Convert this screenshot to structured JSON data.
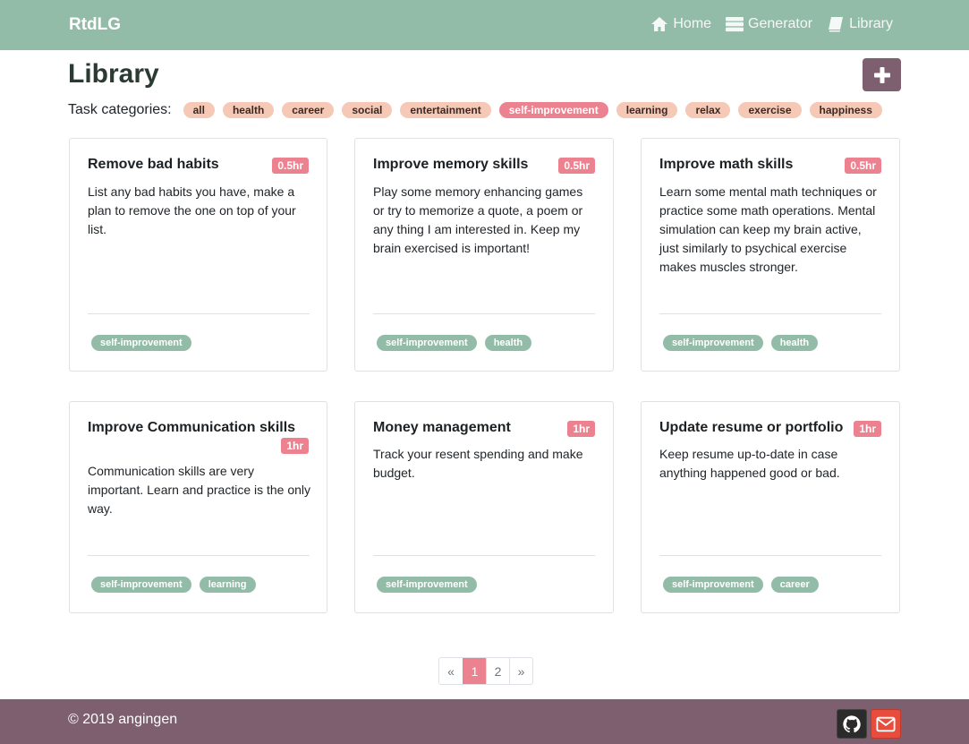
{
  "navbar": {
    "brand": "RtdLG",
    "links": [
      {
        "label": "Home",
        "icon": "home-icon"
      },
      {
        "label": "Generator",
        "icon": "server-icon"
      },
      {
        "label": "Library",
        "icon": "book-icon"
      }
    ]
  },
  "page": {
    "title": "Library",
    "add_button_icon": "plus-icon"
  },
  "categories": {
    "label": "Task categories:",
    "items": [
      "all",
      "health",
      "career",
      "social",
      "entertainment",
      "self-improvement",
      "learning",
      "relax",
      "exercise",
      "happiness"
    ],
    "active": "self-improvement"
  },
  "cards": [
    {
      "title": "Remove bad habits",
      "duration": "0.5hr",
      "text": "List any bad habits you have, make a plan to remove the one on top of your list.",
      "tags": [
        "self-improvement"
      ]
    },
    {
      "title": "Improve memory skills",
      "duration": "0.5hr",
      "text": "Play some memory enhancing games or try to memorize a quote, a poem or any thing I am interested in. Keep my brain exercised is important!",
      "tags": [
        "self-improvement",
        "health"
      ]
    },
    {
      "title": "Improve math skills",
      "duration": "0.5hr",
      "text": "Learn some mental math techniques or practice some math operations. Mental simulation can keep my brain active, just similarly to psychical exercise makes muscles stronger.",
      "tags": [
        "self-improvement",
        "health"
      ]
    },
    {
      "title": "Improve Communication skills",
      "duration": "1hr",
      "text": "Communication skills are very important. Learn and practice is the only way.",
      "tags": [
        "self-improvement",
        "learning"
      ]
    },
    {
      "title": "Money management",
      "duration": "1hr",
      "text": "Track your resent spending and make budget.",
      "tags": [
        "self-improvement"
      ]
    },
    {
      "title": "Update resume or portfolio",
      "duration": "1hr",
      "text": "Keep resume up-to-date in case anything happened good or bad.",
      "tags": [
        "self-improvement",
        "career"
      ]
    }
  ],
  "pagination": {
    "prev": "«",
    "pages": [
      "1",
      "2"
    ],
    "current": "1",
    "next": "»"
  },
  "footer": {
    "copyright": "© 2019 angingen",
    "github_icon": "github-icon",
    "mail_icon": "envelope-icon"
  },
  "colors": {
    "navbar": "#93bca8",
    "footer": "#7d5f70",
    "badge": "#ec8290",
    "category_pill": "#f6c8b6",
    "tag": "#93bca8"
  }
}
